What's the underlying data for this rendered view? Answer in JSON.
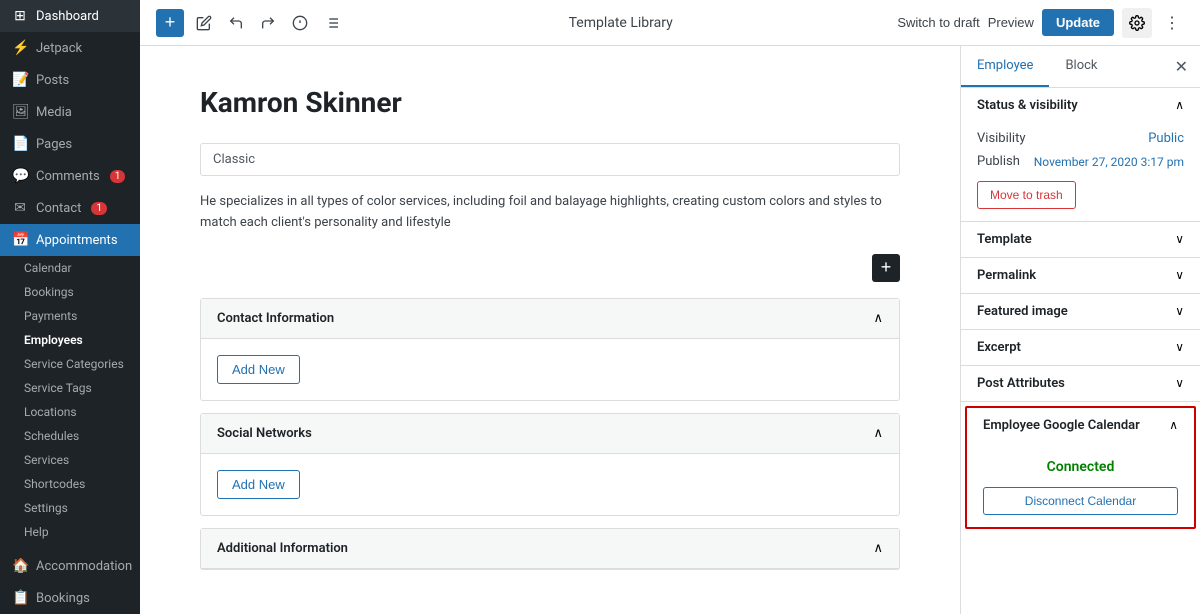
{
  "sidebar": {
    "items": [
      {
        "id": "dashboard",
        "label": "Dashboard",
        "icon": "⊞",
        "active": false
      },
      {
        "id": "jetpack",
        "label": "Jetpack",
        "icon": "⚡",
        "active": false
      },
      {
        "id": "posts",
        "label": "Posts",
        "icon": "📝",
        "active": false
      },
      {
        "id": "media",
        "label": "Media",
        "icon": "🖼",
        "active": false
      },
      {
        "id": "pages",
        "label": "Pages",
        "icon": "📄",
        "active": false
      },
      {
        "id": "comments",
        "label": "Comments",
        "icon": "💬",
        "active": false,
        "badge": "1"
      },
      {
        "id": "contact",
        "label": "Contact",
        "icon": "✉",
        "active": false,
        "badge": "1"
      },
      {
        "id": "appointments",
        "label": "Appointments",
        "icon": "📅",
        "active": true
      }
    ],
    "children": [
      {
        "id": "calendar",
        "label": "Calendar",
        "active": false
      },
      {
        "id": "bookings",
        "label": "Bookings",
        "active": false
      },
      {
        "id": "payments",
        "label": "Payments",
        "active": false
      },
      {
        "id": "employees",
        "label": "Employees",
        "active": true
      },
      {
        "id": "service-categories",
        "label": "Service Categories",
        "active": false
      },
      {
        "id": "service-tags",
        "label": "Service Tags",
        "active": false
      },
      {
        "id": "locations",
        "label": "Locations",
        "active": false
      },
      {
        "id": "schedules",
        "label": "Schedules",
        "active": false
      },
      {
        "id": "services",
        "label": "Services",
        "active": false
      },
      {
        "id": "shortcodes",
        "label": "Shortcodes",
        "active": false
      },
      {
        "id": "settings",
        "label": "Settings",
        "active": false
      },
      {
        "id": "help",
        "label": "Help",
        "active": false
      }
    ],
    "bottom_items": [
      {
        "id": "accommodation",
        "label": "Accommodation",
        "icon": "🏠",
        "active": false
      },
      {
        "id": "bookings2",
        "label": "Bookings",
        "icon": "📋",
        "active": false
      }
    ]
  },
  "topbar": {
    "title": "Template Library",
    "btn_draft": "Switch to draft",
    "btn_preview": "Preview",
    "btn_update": "Update"
  },
  "editor": {
    "page_title": "Kamron Skinner",
    "classic_label": "Classic",
    "description": "He specializes in all types of color services, including foil and balayage highlights, creating custom colors and styles to match each client's personality and lifestyle",
    "sections": [
      {
        "id": "contact-info",
        "title": "Contact Information",
        "expanded": true
      },
      {
        "id": "social-networks",
        "title": "Social Networks",
        "expanded": true
      },
      {
        "id": "additional-info",
        "title": "Additional Information",
        "expanded": false
      }
    ],
    "add_new_label": "Add New"
  },
  "right_panel": {
    "tabs": [
      {
        "id": "employee",
        "label": "Employee",
        "active": true
      },
      {
        "id": "block",
        "label": "Block",
        "active": false
      }
    ],
    "sections": [
      {
        "id": "status-visibility",
        "title": "Status & visibility",
        "expanded": true,
        "visibility_label": "Visibility",
        "visibility_value": "Public",
        "publish_label": "Publish",
        "publish_value": "November 27, 2020 3:17 pm",
        "move_to_trash": "Move to trash"
      },
      {
        "id": "template",
        "title": "Template",
        "expanded": false
      },
      {
        "id": "permalink",
        "title": "Permalink",
        "expanded": false
      },
      {
        "id": "featured-image",
        "title": "Featured image",
        "expanded": false
      },
      {
        "id": "excerpt",
        "title": "Excerpt",
        "expanded": false
      },
      {
        "id": "post-attributes",
        "title": "Post Attributes",
        "expanded": false
      }
    ],
    "google_calendar": {
      "title": "Employee Google Calendar",
      "status": "Connected",
      "disconnect_btn": "Disconnect Calendar"
    }
  }
}
